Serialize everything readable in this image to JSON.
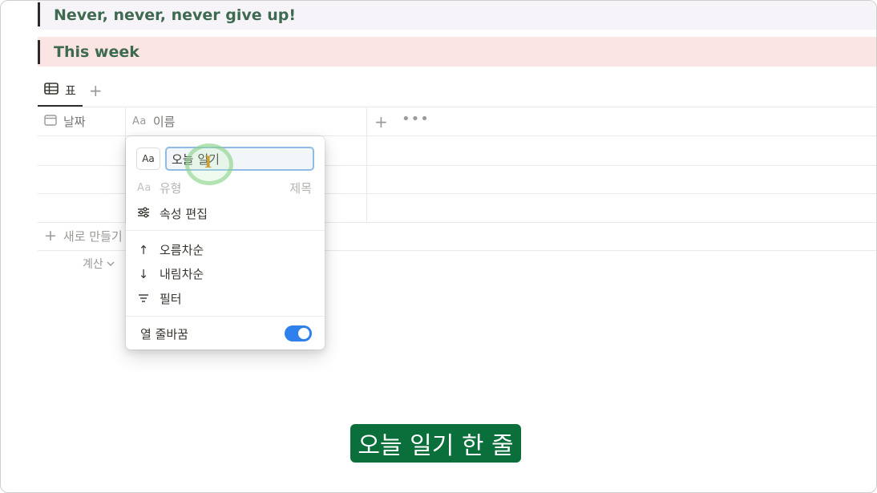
{
  "callouts": [
    {
      "text": "Never, never, never give up!",
      "background": "#f7f4f9",
      "color": "#3e6b4f"
    },
    {
      "text": "This week",
      "background": "#fbe4e4",
      "color": "#3e6b4f"
    }
  ],
  "view_tabs": {
    "active_tab": {
      "label": "표",
      "icon": "table-icon"
    },
    "add_icon": "plus-icon"
  },
  "table": {
    "columns": [
      {
        "label": "날짜",
        "icon": "calendar-icon"
      },
      {
        "label": "이름",
        "icon_text": "Aa"
      }
    ],
    "new_row_label": "새로 만들기",
    "calc_label": "계산"
  },
  "property_menu": {
    "type_badge": "Aa",
    "name_value": "오늘 일기",
    "type_label": "유형",
    "type_icon_text": "Aa",
    "type_value": "제목",
    "edit_property_label": "속성 편집",
    "sort_ascending_label": "오름차순",
    "sort_descending_label": "내림차순",
    "filter_label": "필터",
    "wrap_column_label": "열 줄바꿈",
    "wrap_column_enabled": true
  },
  "subtitle": {
    "text": "오늘 일기 한 줄",
    "background": "#0a6f3a"
  }
}
